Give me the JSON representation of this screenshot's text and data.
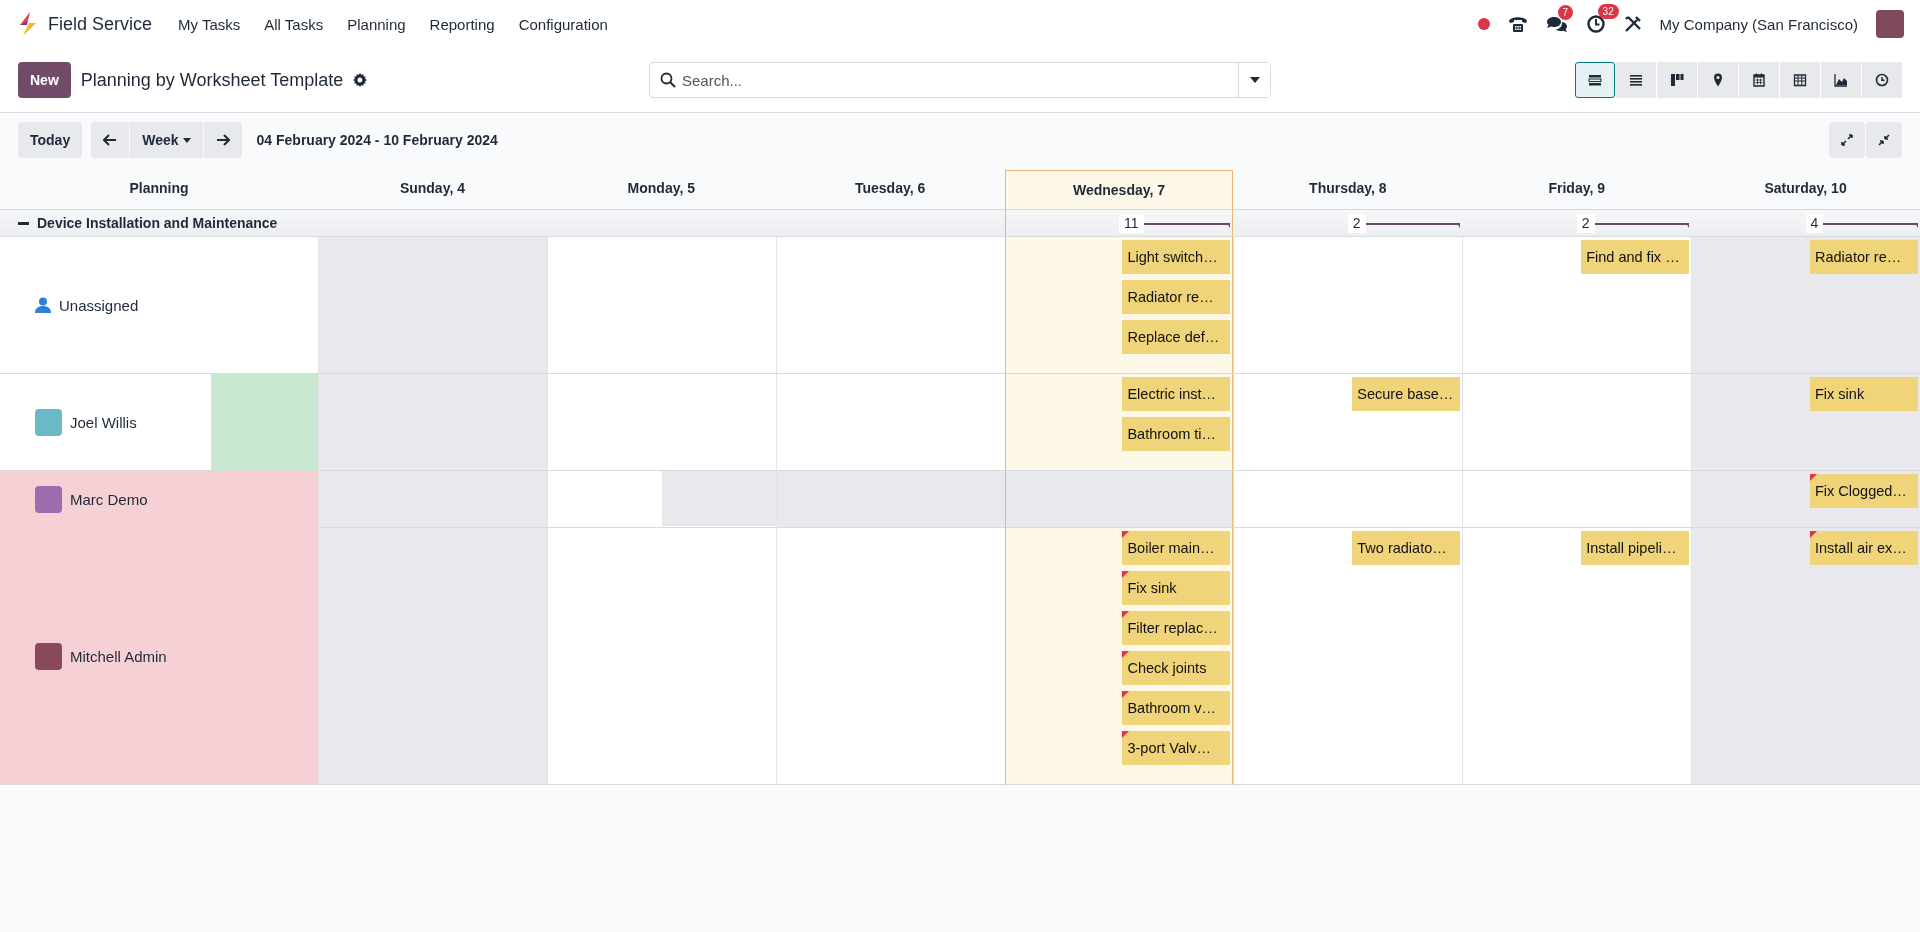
{
  "navbar": {
    "app_name": "Field Service",
    "menu": [
      "My Tasks",
      "All Tasks",
      "Planning",
      "Reporting",
      "Configuration"
    ],
    "messages_badge": "7",
    "activities_badge": "32",
    "company": "My Company (San Francisco)"
  },
  "control_panel": {
    "new_button": "New",
    "title": "Planning by Worksheet Template",
    "search": {
      "placeholder": "Search..."
    },
    "views": [
      {
        "kind": "gantt",
        "selected": true
      },
      {
        "kind": "list",
        "selected": false
      },
      {
        "kind": "kanban",
        "selected": false
      },
      {
        "kind": "map",
        "selected": false
      },
      {
        "kind": "calendar",
        "selected": false
      },
      {
        "kind": "pivot",
        "selected": false
      },
      {
        "kind": "graph",
        "selected": false
      },
      {
        "kind": "activity",
        "selected": false
      }
    ]
  },
  "gantt_toolbar": {
    "today": "Today",
    "scale": "Week",
    "range": "04 February 2024 - 10 February 2024"
  },
  "gantt": {
    "header": "Planning",
    "days": [
      {
        "label": "Sunday, 4",
        "today": false
      },
      {
        "label": "Monday, 5",
        "today": false
      },
      {
        "label": "Tuesday, 6",
        "today": false
      },
      {
        "label": "Wednesday, 7",
        "today": true,
        "count": "11"
      },
      {
        "label": "Thursday, 8",
        "today": false,
        "count": "2"
      },
      {
        "label": "Friday, 9",
        "today": false,
        "count": "2"
      },
      {
        "label": "Saturday, 10",
        "today": false,
        "count": "4"
      }
    ],
    "group": {
      "name": "Device Installation and Maintenance",
      "expanded": true
    },
    "rows": [
      {
        "name": "Unassigned",
        "kind": "unassigned",
        "overloaded": false,
        "partly_planned": false,
        "cells": [
          {
            "unavailable": true
          },
          {
            "unavailable": false
          },
          {
            "unavailable": false
          },
          {
            "unavailable": false,
            "tasks": [
              {
                "name": "Light switch…",
                "flagged": false
              },
              {
                "name": "Radiator re…",
                "flagged": false
              },
              {
                "name": "Replace def…",
                "flagged": false
              }
            ]
          },
          {
            "unavailable": false
          },
          {
            "unavailable": false,
            "tasks": [
              {
                "name": "Find and fix …",
                "flagged": false
              }
            ]
          },
          {
            "unavailable": true,
            "tasks": [
              {
                "name": "Radiator re…",
                "flagged": false
              }
            ]
          }
        ]
      },
      {
        "name": "Joel Willis",
        "kind": "user",
        "color": "#6bb8c6",
        "overloaded": false,
        "partly_planned": true,
        "cells": [
          {
            "unavailable": true
          },
          {
            "unavailable": false
          },
          {
            "unavailable": false
          },
          {
            "unavailable": false,
            "tasks": [
              {
                "name": "Electric inst…",
                "flagged": false
              },
              {
                "name": "Bathroom ti…",
                "flagged": false
              }
            ]
          },
          {
            "unavailable": false,
            "tasks": [
              {
                "name": "Secure base…",
                "flagged": false
              }
            ]
          },
          {
            "unavailable": false
          },
          {
            "unavailable": true,
            "tasks": [
              {
                "name": "Fix sink",
                "flagged": false
              }
            ]
          }
        ]
      },
      {
        "name": "Marc Demo",
        "kind": "user",
        "color": "#9b6cae",
        "overloaded": true,
        "partly_planned": false,
        "cells": [
          {
            "unavailable": true
          },
          {
            "unavailable": true,
            "half_day": true
          },
          {
            "unavailable": true
          },
          {
            "unavailable": true
          },
          {
            "unavailable": false
          },
          {
            "unavailable": false
          },
          {
            "unavailable": true,
            "tasks": [
              {
                "name": "Fix Clogged…",
                "flagged": true
              }
            ]
          }
        ]
      },
      {
        "name": "Mitchell Admin",
        "kind": "user",
        "color": "#8b4a5c",
        "overloaded": true,
        "partly_planned": false,
        "cells": [
          {
            "unavailable": true
          },
          {
            "unavailable": false
          },
          {
            "unavailable": false
          },
          {
            "unavailable": false,
            "tasks": [
              {
                "name": "Boiler main…",
                "flagged": true
              },
              {
                "name": "Fix sink",
                "flagged": true
              },
              {
                "name": "Filter replac…",
                "flagged": true
              },
              {
                "name": "Check joints",
                "flagged": true
              },
              {
                "name": "Bathroom v…",
                "flagged": true
              },
              {
                "name": "3-port Valv…",
                "flagged": true
              }
            ]
          },
          {
            "unavailable": false,
            "tasks": [
              {
                "name": "Two radiato…",
                "flagged": false
              }
            ]
          },
          {
            "unavailable": false,
            "tasks": [
              {
                "name": "Install pipeli…",
                "flagged": false
              }
            ]
          },
          {
            "unavailable": true,
            "tasks": [
              {
                "name": "Install air ex…",
                "flagged": true
              }
            ]
          }
        ]
      }
    ]
  }
}
